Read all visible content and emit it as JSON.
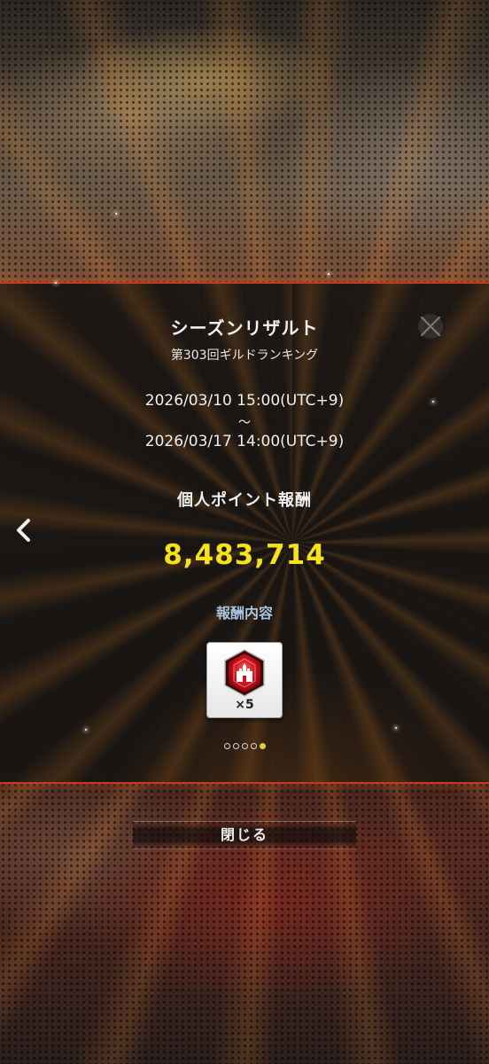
{
  "dialog": {
    "title": "シーズンリザルト",
    "subtitle": "第303回ギルドランキング",
    "period_start": "2026/03/10 15:00(UTC+9)",
    "period_separator": "〜",
    "period_end": "2026/03/17 14:00(UTC+9)",
    "reward_label": "個人ポイント報酬",
    "points": "8,483,714",
    "reward_heading": "報酬内容",
    "reward_item": {
      "icon": "red-castle-gem-icon",
      "quantity": "×5"
    },
    "pagination": {
      "total": 5,
      "active_index": 4
    }
  },
  "close_button": {
    "label": "閉じる"
  },
  "colors": {
    "accent_border": "#c43a20",
    "points": "#f5e21b",
    "reward_heading": "#a8c4dc",
    "active_dot": "#e8c93a"
  }
}
